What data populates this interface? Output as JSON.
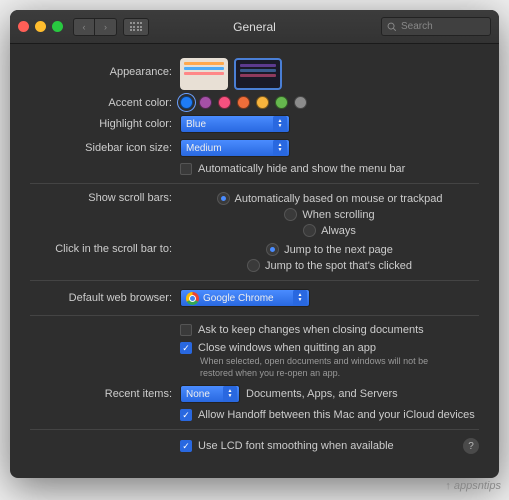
{
  "window": {
    "title": "General"
  },
  "search": {
    "placeholder": "Search"
  },
  "labels": {
    "appearance": "Appearance:",
    "accent": "Accent color:",
    "highlight": "Highlight color:",
    "sidebar": "Sidebar icon size:",
    "autohide": "Automatically hide and show the menu bar",
    "scrollbars": "Show scroll bars:",
    "scroll_auto": "Automatically based on mouse or trackpad",
    "scroll_when": "When scrolling",
    "scroll_always": "Always",
    "clickbar": "Click in the scroll bar to:",
    "click_jump": "Jump to the next page",
    "click_spot": "Jump to the spot that's clicked",
    "browser": "Default web browser:",
    "ask_changes": "Ask to keep changes when closing documents",
    "close_win": "Close windows when quitting an app",
    "close_sub": "When selected, open documents and windows will not be restored when you re-open an app.",
    "recent": "Recent items:",
    "recent_suffix": "Documents, Apps, and Servers",
    "handoff": "Allow Handoff between this Mac and your iCloud devices",
    "lcd": "Use LCD font smoothing when available"
  },
  "values": {
    "highlight": "Blue",
    "sidebar": "Medium",
    "browser": "Google Chrome",
    "recent": "None"
  },
  "accent_colors": [
    "#1e7bf5",
    "#a550a7",
    "#f7517f",
    "#ef6e3a",
    "#f7b43d",
    "#66b84e",
    "#8c8c8c"
  ],
  "watermark": "appsntips"
}
